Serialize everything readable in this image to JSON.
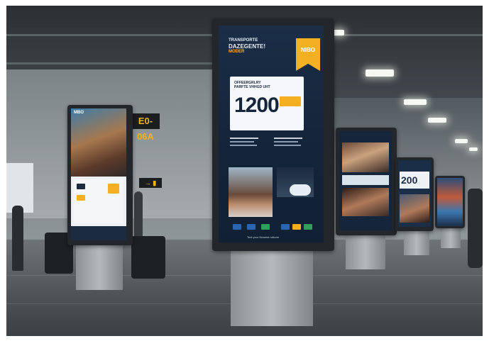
{
  "scene": {
    "subject": "airport terminal digital signage kiosks",
    "colors": {
      "screen_bg": "#15253b",
      "accent": "#f4b021",
      "floor": "#4d5256"
    }
  },
  "signage": {
    "gate_sign": "E0-06A",
    "direction_sign": "→ ▮"
  },
  "main_kiosk": {
    "header_lines": [
      "TRANSPORTE",
      "DAZEGENTE!"
    ],
    "header_accent": "MODER",
    "badge_text": "NIBO",
    "promo_lines": [
      "OFFEERGRLRY",
      "PARFTE VHHGD UHT"
    ],
    "promo_number": "1200",
    "footer_text": "Text your Nearest rutturer"
  },
  "left_kiosk": {
    "title": "MBO"
  },
  "far_kiosk": {
    "promo_number": "200"
  }
}
